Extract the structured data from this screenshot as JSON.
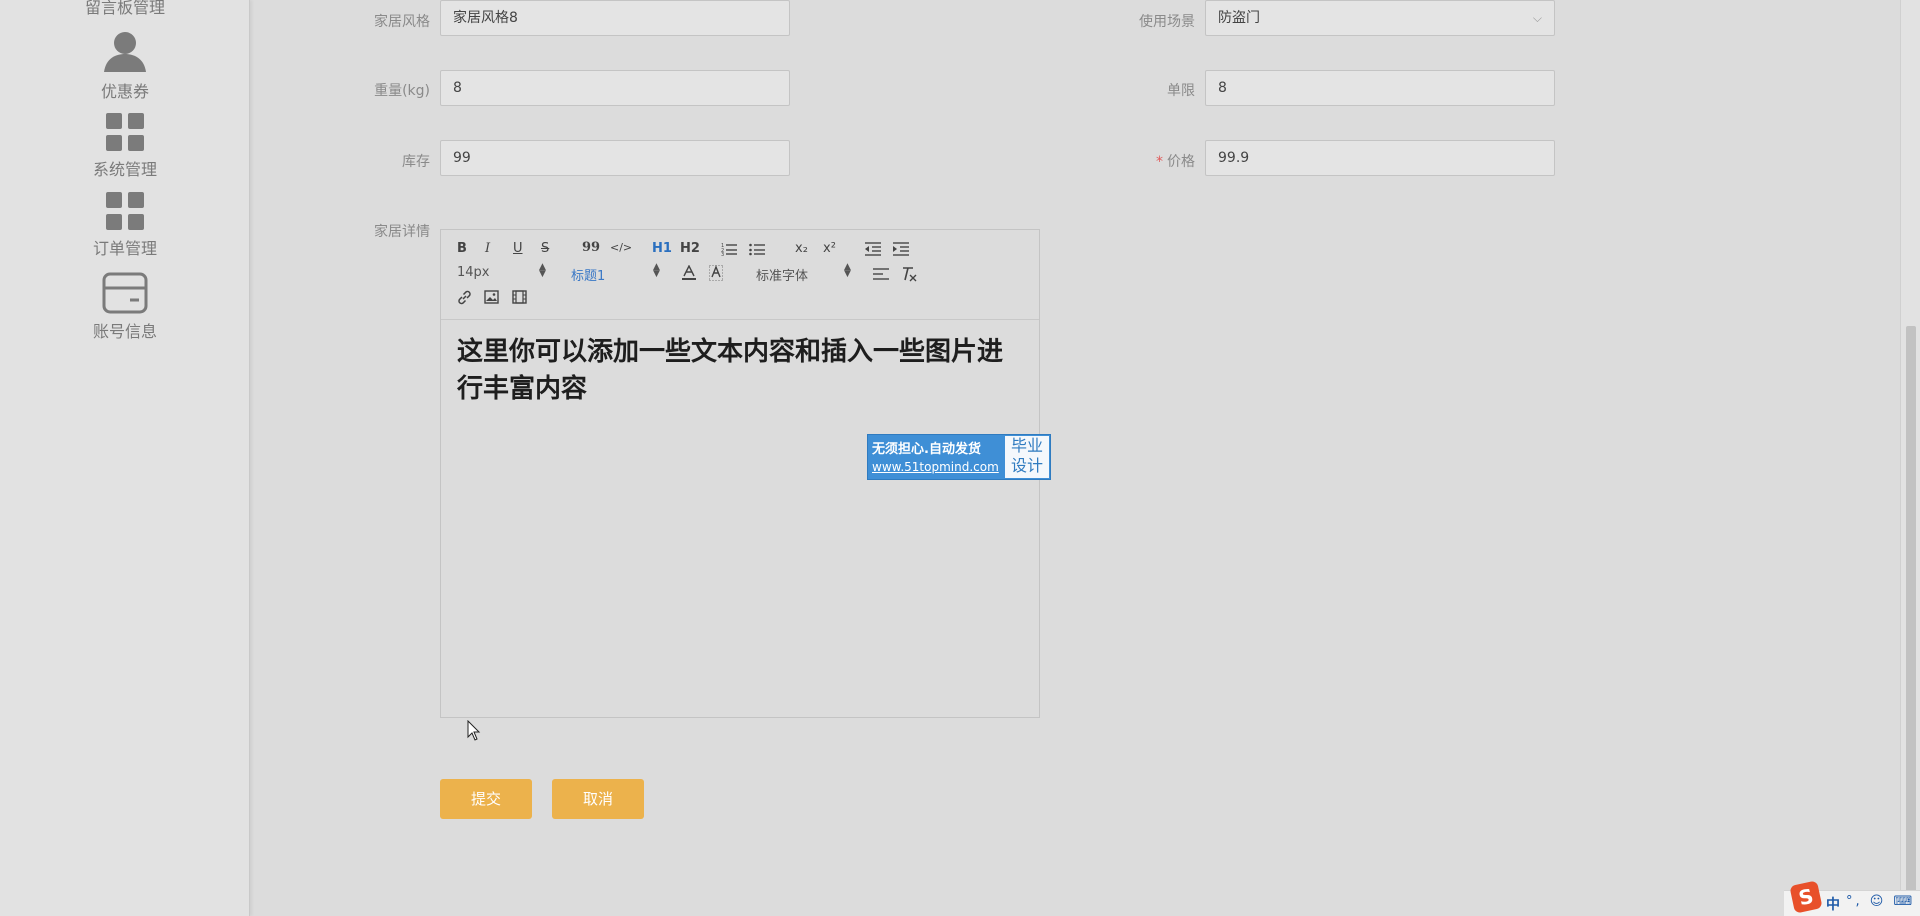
{
  "sidebar": {
    "top_label": "留言板管理",
    "items": [
      {
        "label": "优惠券",
        "icon": "user-icon"
      },
      {
        "label": "系统管理",
        "icon": "grid-icon"
      },
      {
        "label": "订单管理",
        "icon": "grid-icon"
      },
      {
        "label": "账号信息",
        "icon": "card-icon"
      }
    ]
  },
  "form": {
    "style": {
      "label": "家居风格",
      "value": "家居风格8"
    },
    "scene": {
      "label": "使用场景",
      "value": "防盗门"
    },
    "weight": {
      "label": "重量(kg)",
      "value": "8"
    },
    "limit": {
      "label": "单限",
      "value": "8"
    },
    "stock": {
      "label": "库存",
      "value": "99"
    },
    "price": {
      "label": "价格",
      "required_mark": "*",
      "value": "99.9"
    },
    "detail": {
      "label": "家居详情"
    }
  },
  "editor": {
    "toolbar": {
      "bold": "B",
      "italic": "I",
      "underline": "U",
      "strike": "S",
      "quote": "99",
      "code": "</>",
      "h1": "H1",
      "h2": "H2",
      "ol": "ordered-list-icon",
      "ul": "bullet-list-icon",
      "sub": "x₂",
      "sup": "x²",
      "size_select": "14px",
      "header_select": "标题1",
      "font_select": "标准字体"
    },
    "content": "这里你可以添加一些文本内容和插入一些图片进行丰富内容"
  },
  "badge": {
    "line1": "无须担心.自动发货",
    "line2": "www.51topmind.com",
    "right_top": "毕业",
    "right_bottom": "设计"
  },
  "buttons": {
    "submit": "提交",
    "cancel": "取消"
  },
  "tray": {
    "ime": "中"
  },
  "colors": {
    "accent": "#ecb24c",
    "required": "#e05a5a",
    "link_blue": "#2a6fbf"
  }
}
